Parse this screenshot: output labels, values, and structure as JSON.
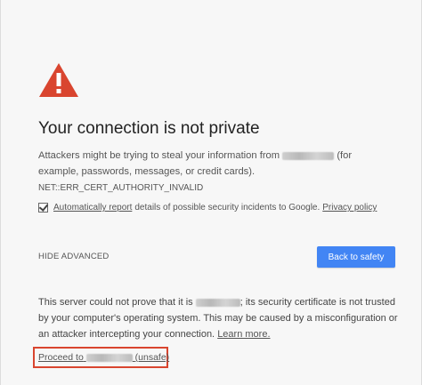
{
  "icon": {
    "name": "warning-triangle-icon",
    "color": "#d9452f"
  },
  "title": "Your connection is not private",
  "description": {
    "part1": "Attackers might be trying to steal your information from",
    "part2": "(for example, passwords, messages, or credit cards).",
    "error_code": "NET::ERR_CERT_AUTHORITY_INVALID"
  },
  "report": {
    "checked": true,
    "link_label": "Automatically report",
    "text": "details of possible security incidents to Google.",
    "privacy_label": "Privacy policy"
  },
  "hide_advanced_label": "HIDE ADVANCED",
  "back_button_label": "Back to safety",
  "details": {
    "part1": "This server could not prove that it is",
    "part2": "; its security certificate is not trusted by your computer's operating system. This may be caused by a misconfiguration or an attacker intercepting your connection.",
    "learn_more_label": "Learn more."
  },
  "proceed": {
    "prefix": "Proceed to",
    "suffix": "(unsafe)"
  },
  "colors": {
    "accent": "#4285f4",
    "highlight_box": "#d9452f"
  }
}
